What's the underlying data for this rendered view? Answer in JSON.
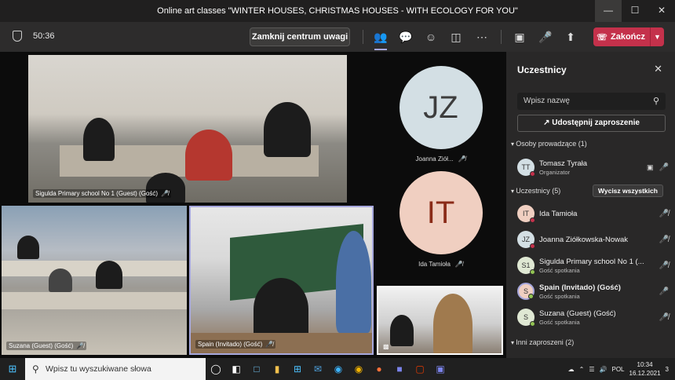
{
  "window": {
    "title": "Online art classes \"WINTER HOUSES, CHRISTMAS HOUSES - WITH ECOLOGY FOR YOU\"",
    "controls": [
      "—",
      "☐",
      "✕"
    ]
  },
  "toolbar": {
    "timer": "50:36",
    "close_focus": "Zamknij centrum uwagi",
    "end_call": "Zakończ"
  },
  "videos": [
    {
      "caption": "Sigulda Primary school No 1 (Guest) (Gość)"
    },
    {
      "caption": "Suzana (Guest) (Gość)"
    },
    {
      "caption": "Spain (Invitado) (Gość)"
    }
  ],
  "avatars": [
    {
      "initials": "JZ",
      "name": "Joanna Ziół...",
      "color": "#d3dfe4"
    },
    {
      "initials": "IT",
      "name": "Ida Tamioła",
      "color": "#f0cfc1"
    }
  ],
  "panel": {
    "title": "Uczestnicy",
    "search_placeholder": "Wpisz nazwę",
    "share_label": "Udostępnij zaproszenie",
    "presenters_header": "Osoby prowadzące (1)",
    "attendees_header": "Uczestnicy (5)",
    "remove_all": "Wycisz wszystkich",
    "others_header": "Inni zaproszeni (2)",
    "presenters": [
      {
        "initials": "TT",
        "name": "Tomasz Tyrała",
        "role": "Organizator",
        "color": "#d3dfe4"
      }
    ],
    "attendees": [
      {
        "initials": "IT",
        "name": "Ida Tamioła",
        "role": "",
        "color": "#f0cfc1"
      },
      {
        "initials": "JZ",
        "name": "Joanna Ziółkowska-Nowak",
        "role": "",
        "color": "#d3dfe4"
      },
      {
        "initials": "S1",
        "name": "Sigulda Primary school No 1 (...",
        "role": "Gość spotkania",
        "color": "#dfe8d3"
      },
      {
        "initials": "S",
        "name": "Spain (Invitado) (Gość)",
        "role": "Gość spotkania",
        "color": "#f0cfc1"
      },
      {
        "initials": "S",
        "name": "Suzana (Guest) (Gość)",
        "role": "Gość spotkania",
        "color": "#dfe8d3"
      }
    ]
  },
  "taskbar": {
    "search_placeholder": "Wpisz tu wyszukiwane słowa",
    "language": "POL",
    "time": "10:34",
    "date": "16.12.2021",
    "notifications": "3"
  }
}
